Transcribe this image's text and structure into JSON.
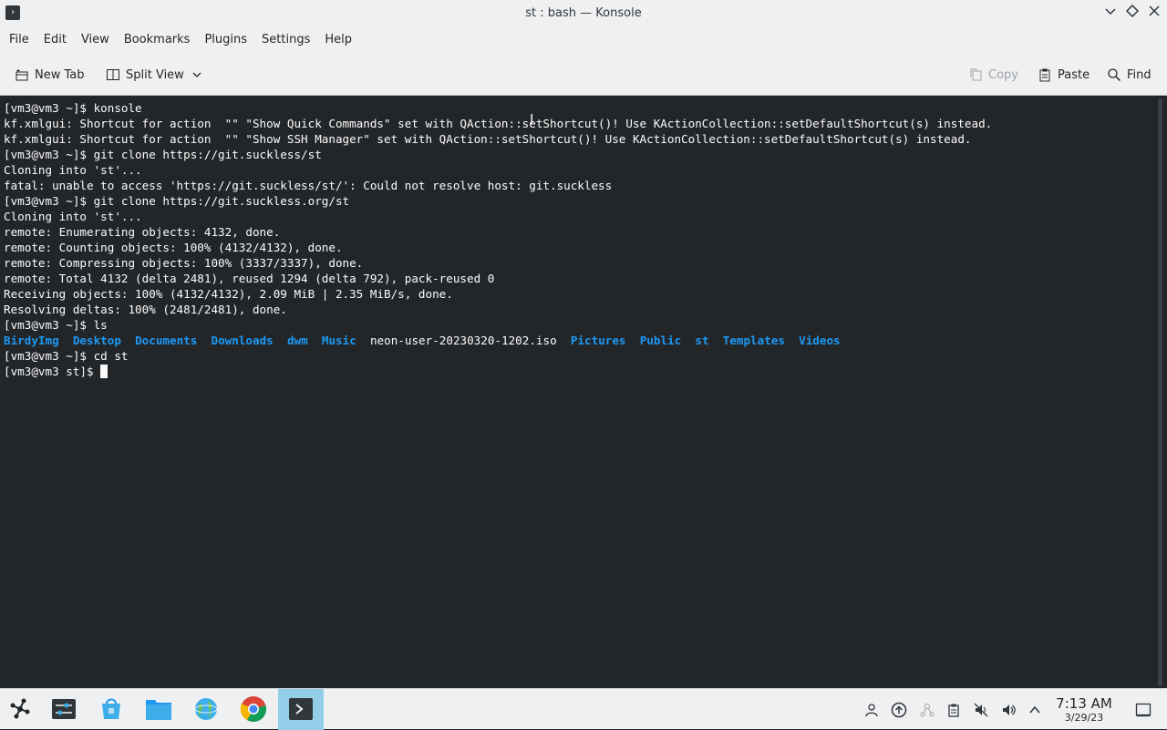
{
  "window": {
    "title": "st : bash — Konsole"
  },
  "menubar": {
    "items": [
      "File",
      "Edit",
      "View",
      "Bookmarks",
      "Plugins",
      "Settings",
      "Help"
    ]
  },
  "toolbar": {
    "new_tab": "New Tab",
    "split_view": "Split View",
    "copy": "Copy",
    "paste": "Paste",
    "find": "Find"
  },
  "terminal": {
    "lines": [
      "[vm3@vm3 ~]$ konsole",
      "kf.xmlgui: Shortcut for action  \"\" \"Show Quick Commands\" set with QAction::setShortcut()! Use KActionCollection::setDefaultShortcut(s) instead.",
      "kf.xmlgui: Shortcut for action  \"\" \"Show SSH Manager\" set with QAction::setShortcut()! Use KActionCollection::setDefaultShortcut(s) instead.",
      "[vm3@vm3 ~]$ git clone https://git.suckless/st",
      "Cloning into 'st'...",
      "fatal: unable to access 'https://git.suckless/st/': Could not resolve host: git.suckless",
      "[vm3@vm3 ~]$ git clone https://git.suckless.org/st",
      "Cloning into 'st'...",
      "remote: Enumerating objects: 4132, done.",
      "remote: Counting objects: 100% (4132/4132), done.",
      "remote: Compressing objects: 100% (3337/3337), done.",
      "remote: Total 4132 (delta 2481), reused 1294 (delta 792), pack-reused 0",
      "Receiving objects: 100% (4132/4132), 2.09 MiB | 2.35 MiB/s, done.",
      "Resolving deltas: 100% (2481/2481), done.",
      "[vm3@vm3 ~]$ ls"
    ],
    "ls_entries": [
      {
        "name": "BirdyImg",
        "type": "dir"
      },
      {
        "name": "Desktop",
        "type": "dir"
      },
      {
        "name": "Documents",
        "type": "dir"
      },
      {
        "name": "Downloads",
        "type": "dir"
      },
      {
        "name": "dwm",
        "type": "dir"
      },
      {
        "name": "Music",
        "type": "dir"
      },
      {
        "name": "neon-user-20230320-1202.iso",
        "type": "file"
      },
      {
        "name": "Pictures",
        "type": "dir"
      },
      {
        "name": "Public",
        "type": "dir"
      },
      {
        "name": "st",
        "type": "dir"
      },
      {
        "name": "Templates",
        "type": "dir"
      },
      {
        "name": "Videos",
        "type": "dir"
      }
    ],
    "after_lines": [
      "[vm3@vm3 ~]$ cd st"
    ],
    "prompt": "[vm3@vm3 st]$ "
  },
  "taskbar": {
    "icons": [
      "app-launcher-icon",
      "system-settings-icon",
      "discover-icon",
      "file-manager-icon",
      "network-globe-icon",
      "chrome-icon",
      "konsole-icon"
    ]
  },
  "tray": {
    "icons": [
      "user-icon",
      "update-icon",
      "network-icon",
      "clipboard-icon",
      "muted-icon",
      "volume-icon",
      "chevron-up-icon"
    ]
  },
  "clock": {
    "time": "7:13 AM",
    "date": "3/29/23"
  },
  "colors": {
    "terminal_bg": "#232629",
    "terminal_fg": "#fcfcfc",
    "ls_dir": "#1d99f3",
    "chrome_bg": "#eff0f1",
    "task_active": "#93cee9"
  }
}
